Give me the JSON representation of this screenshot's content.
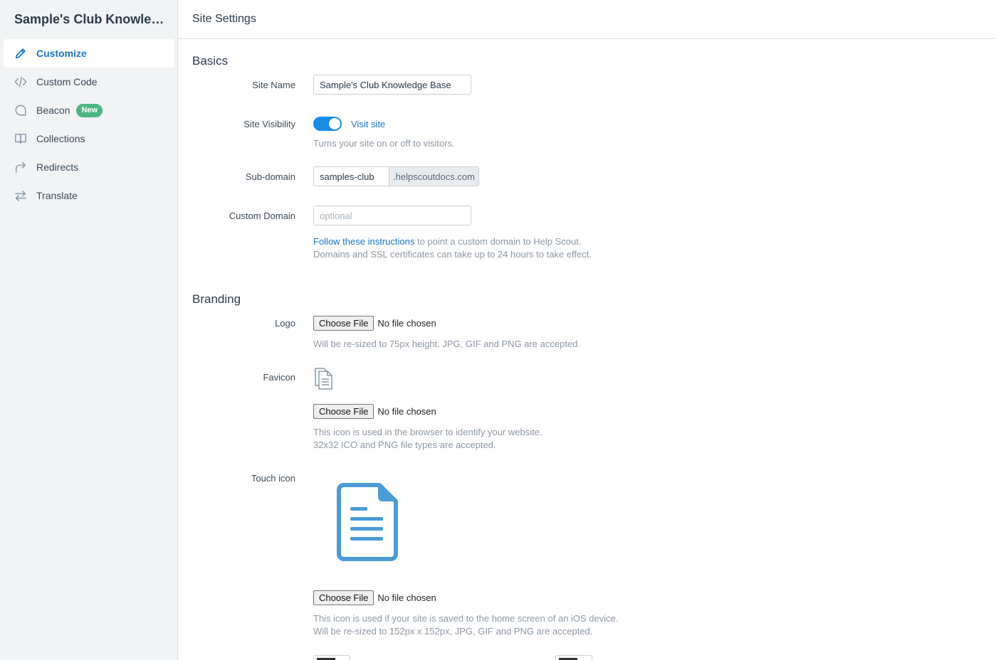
{
  "sidebar": {
    "site_title": "Sample's Club Knowledge Base",
    "items": [
      {
        "label": "Customize",
        "icon": "pencil-icon",
        "active": true
      },
      {
        "label": "Custom Code",
        "icon": "code-icon"
      },
      {
        "label": "Beacon",
        "icon": "chat-bubble-icon",
        "badge": "New"
      },
      {
        "label": "Collections",
        "icon": "book-icon"
      },
      {
        "label": "Redirects",
        "icon": "redirect-arrow-icon"
      },
      {
        "label": "Translate",
        "icon": "swap-arrows-icon"
      }
    ]
  },
  "header": {
    "title": "Site Settings"
  },
  "basics": {
    "title": "Basics",
    "site_name": {
      "label": "Site Name",
      "value": "Sample's Club Knowledge Base"
    },
    "visibility": {
      "label": "Site Visibility",
      "enabled": true,
      "link": "Visit site",
      "hint": "Turns your site on or off to visitors."
    },
    "subdomain": {
      "label": "Sub-domain",
      "value": "samples-club",
      "suffix": ".helpscoutdocs.com"
    },
    "custom_domain": {
      "label": "Custom Domain",
      "placeholder": "optional",
      "hint_link": "Follow these instructions",
      "hint_rest": " to point a custom domain to Help Scout.",
      "hint_line2": "Domains and SSL certificates can take up to 24 hours to take effect."
    }
  },
  "branding": {
    "title": "Branding",
    "logo": {
      "label": "Logo",
      "button": "Choose File",
      "status": "No file chosen",
      "hint": "Will be re-sized to 75px height. JPG, GIF and PNG are accepted"
    },
    "favicon": {
      "label": "Favicon",
      "icon": "document-icon",
      "button": "Choose File",
      "status": "No file chosen",
      "hint_line1": "This icon is used in the browser to identify your website.",
      "hint_line2": "32x32 ICO and PNG file types are accepted."
    },
    "touch_icon": {
      "label": "Touch icon",
      "icon": "document-lines-icon",
      "icon_color": "#4a9bd8",
      "button": "Choose File",
      "status": "No file chosen",
      "hint_line1": "This icon is used if your site is saved to the home screen of an iOS device.",
      "hint_line2": "Will be re-sized to 152px x 152px, JPG, GIF and PNG are accepted."
    }
  },
  "colors": {
    "accent": "#1a73c9",
    "toggle": "#1a8be6",
    "badge": "#4cb584"
  }
}
